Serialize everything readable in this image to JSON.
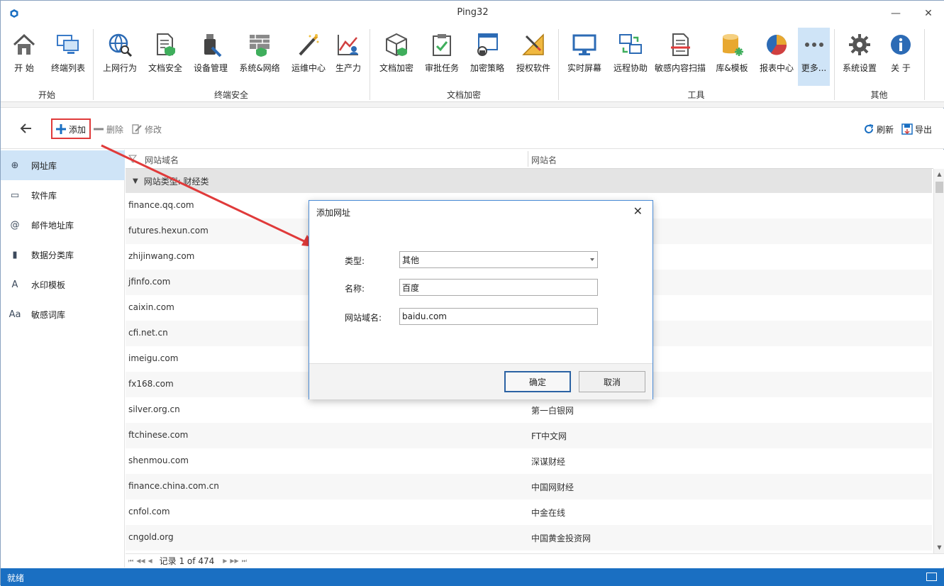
{
  "window": {
    "title": "Ping32",
    "minimize": "—",
    "maximize": "☐",
    "close": "✕"
  },
  "ribbon": {
    "items": [
      {
        "label": "开 始",
        "icon": "home-icon"
      },
      {
        "label": "终端列表",
        "icon": "terminal-list-icon"
      },
      {
        "label": "上网行为",
        "icon": "web-behavior-icon"
      },
      {
        "label": "文档安全",
        "icon": "document-security-icon"
      },
      {
        "label": "设备管理",
        "icon": "device-management-icon"
      },
      {
        "label": "系统&网络",
        "icon": "system-network-icon"
      },
      {
        "label": "运维中心",
        "icon": "ops-center-icon"
      },
      {
        "label": "生产力",
        "icon": "productivity-icon"
      },
      {
        "label": "文档加密",
        "icon": "document-encrypt-icon"
      },
      {
        "label": "审批任务",
        "icon": "approval-task-icon"
      },
      {
        "label": "加密策略",
        "icon": "encrypt-policy-icon"
      },
      {
        "label": "授权软件",
        "icon": "authorized-software-icon"
      },
      {
        "label": "实时屏幕",
        "icon": "live-screen-icon"
      },
      {
        "label": "远程协助",
        "icon": "remote-assist-icon"
      },
      {
        "label": "敏感内容扫描",
        "icon": "sensitive-scan-icon"
      },
      {
        "label": "库&模板",
        "icon": "library-template-icon"
      },
      {
        "label": "报表中心",
        "icon": "report-center-icon"
      },
      {
        "label": "更多...",
        "icon": "more-icon"
      },
      {
        "label": "系统设置",
        "icon": "settings-icon"
      },
      {
        "label": "关 于",
        "icon": "info-icon"
      }
    ],
    "groups": [
      "开始",
      "终端安全",
      "文档加密",
      "工具",
      "其他"
    ]
  },
  "toolbar": {
    "add": "添加",
    "delete": "删除",
    "edit": "修改",
    "refresh": "刷新",
    "export": "导出"
  },
  "sidebar": {
    "items": [
      {
        "label": "网址库",
        "icon": "globe-icon",
        "glyph": "⊕"
      },
      {
        "label": "软件库",
        "icon": "software-window-icon",
        "glyph": "▭"
      },
      {
        "label": "邮件地址库",
        "icon": "at-icon",
        "glyph": "@"
      },
      {
        "label": "数据分类库",
        "icon": "data-category-icon",
        "glyph": "▮"
      },
      {
        "label": "水印模板",
        "icon": "watermark-icon",
        "glyph": "A"
      },
      {
        "label": "敏感词库",
        "icon": "font-aa-icon",
        "glyph": "Aa"
      }
    ]
  },
  "grid": {
    "columns": [
      "网站域名",
      "网站名"
    ],
    "group_label": "网站类型: 财经类",
    "rows": [
      {
        "domain": "finance.qq.com",
        "name": ""
      },
      {
        "domain": "futures.hexun.com",
        "name": ""
      },
      {
        "domain": "zhijinwang.com",
        "name": ""
      },
      {
        "domain": "jfinfo.com",
        "name": ""
      },
      {
        "domain": "caixin.com",
        "name": ""
      },
      {
        "domain": "cfi.net.cn",
        "name": ""
      },
      {
        "domain": "imeigu.com",
        "name": ""
      },
      {
        "domain": "fx168.com",
        "name": ""
      },
      {
        "domain": "silver.org.cn",
        "name": "第一白银网"
      },
      {
        "domain": "ftchinese.com",
        "name": "FT中文网"
      },
      {
        "domain": "shenmou.com",
        "name": "深谋财经"
      },
      {
        "domain": "finance.china.com.cn",
        "name": "中国网财经"
      },
      {
        "domain": "cnfol.com",
        "name": "中金在线"
      },
      {
        "domain": "cngold.org",
        "name": "中国黄金投资网"
      }
    ],
    "pager": {
      "text": "记录 1 of 474"
    }
  },
  "status": {
    "text": "就绪"
  },
  "dialog": {
    "title": "添加网址",
    "type_label": "类型:",
    "type_value": "其他",
    "name_label": "名称:",
    "name_value": "百度",
    "domain_label": "网站域名:",
    "domain_value": "baidu.com",
    "ok": "确定",
    "cancel": "取消"
  },
  "colors": {
    "accent": "#1a6fc2",
    "selection": "#cfe4f7",
    "highlight_box": "#e03a3a"
  }
}
